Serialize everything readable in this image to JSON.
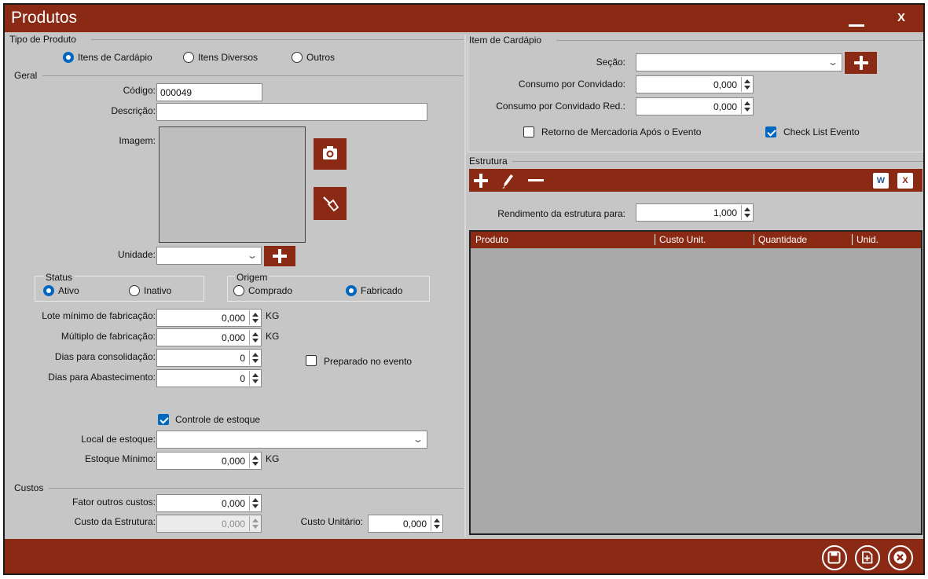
{
  "window": {
    "title": "Produtos",
    "minimize_label": "",
    "close_label": "X"
  },
  "tipo_produto": {
    "group_label": "Tipo de Produto",
    "options": [
      {
        "label": "Itens de Cardápio",
        "selected": true
      },
      {
        "label": "Itens Diversos",
        "selected": false
      },
      {
        "label": "Outros",
        "selected": false
      }
    ]
  },
  "geral": {
    "group_label": "Geral",
    "codigo_label": "Código:",
    "codigo_value": "000049",
    "descricao_label": "Descrição:",
    "descricao_value": "",
    "imagem_label": "Imagem:",
    "unidade_label": "Unidade:",
    "unidade_value": "",
    "status": {
      "group_label": "Status",
      "options": [
        {
          "label": "Ativo",
          "selected": true
        },
        {
          "label": "Inativo",
          "selected": false
        }
      ]
    },
    "origem": {
      "group_label": "Origem",
      "options": [
        {
          "label": "Comprado",
          "selected": false
        },
        {
          "label": "Fabricado",
          "selected": true
        }
      ]
    },
    "lote_label": "Lote mínimo de fabricação:",
    "lote_value": "0,000",
    "lote_unit": "KG",
    "multiplo_label": "Múltiplo de fabricação:",
    "multiplo_value": "0,000",
    "multiplo_unit": "KG",
    "dias_consol_label": "Dias para consolidação:",
    "dias_consol_value": "0",
    "dias_abast_label": "Dias para Abastecimento:",
    "dias_abast_value": "0",
    "preparado_label": "Preparado no evento",
    "preparado_checked": false,
    "controle_label": "Controle de estoque",
    "controle_checked": true,
    "local_label": "Local de estoque:",
    "local_value": "",
    "estoque_min_label": "Estoque Mínimo:",
    "estoque_min_value": "0,000",
    "estoque_min_unit": "KG"
  },
  "custos": {
    "group_label": "Custos",
    "fator_label": "Fator outros custos:",
    "fator_value": "0,000",
    "custo_estrutura_label": "Custo da Estrutura:",
    "custo_estrutura_value": "0,000",
    "custo_unitario_label": "Custo Unitário:",
    "custo_unitario_value": "0,000"
  },
  "item_cardapio": {
    "group_label": "Item de Cardápio",
    "secao_label": "Seção:",
    "secao_value": "",
    "consumo_label": "Consumo por Convidado:",
    "consumo_value": "0,000",
    "consumo_red_label": "Consumo por Convidado Red.:",
    "consumo_red_value": "0,000",
    "retorno_label": "Retorno de Mercadoria Após o Evento",
    "retorno_checked": false,
    "checklist_label": "Check List Evento",
    "checklist_checked": true
  },
  "estrutura": {
    "group_label": "Estrutura",
    "rendimento_label": "Rendimento da estrutura para:",
    "rendimento_value": "1,000",
    "word_icon": "W",
    "excel_icon": "X",
    "columns": [
      "Produto",
      "Custo Unit.",
      "Quantidade",
      "Unid."
    ],
    "rows": []
  },
  "colors": {
    "accent": "#8b2a14",
    "panel": "#c6c6c6",
    "selected": "#0067c0"
  },
  "icons": {
    "camera": "camera-icon",
    "eraser": "eraser-icon",
    "add": "plus-icon",
    "edit": "pencil-icon",
    "remove": "minus-icon",
    "save": "save-icon",
    "new": "new-icon",
    "cancel": "cancel-icon"
  }
}
